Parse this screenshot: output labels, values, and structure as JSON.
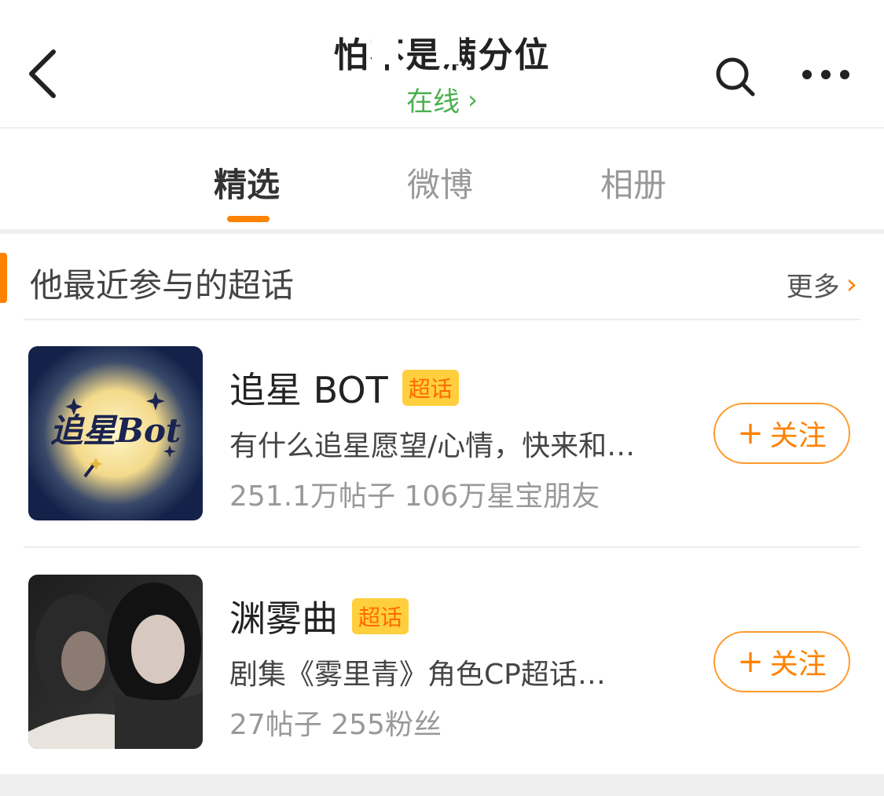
{
  "header": {
    "title": "怕不是满分位",
    "status": "在线",
    "status_chevron": "›",
    "back_icon": "back-icon",
    "search_icon": "search-icon",
    "more_icon": "more-icon"
  },
  "tabs": [
    {
      "label": "精选",
      "active": true
    },
    {
      "label": "微博",
      "active": false
    },
    {
      "label": "相册",
      "active": false
    }
  ],
  "section": {
    "title": "他最近参与的超话",
    "more_label": "更多",
    "more_chevron": "›"
  },
  "items": [
    {
      "name": "追星 BOT",
      "badge": "超话",
      "description": "有什么追星愿望/心情，快来和…",
      "stats": "251.1万帖子 106万星宝朋友",
      "follow_label": "关注",
      "follow_plus": "+",
      "thumb_text": "追星Bot"
    },
    {
      "name": "渊雾曲",
      "badge": "超话",
      "description": "剧集《雾里青》角色CP超话…",
      "stats": "27帖子 255粉丝",
      "follow_label": "关注",
      "follow_plus": "+"
    }
  ],
  "colors": {
    "accent": "#ff8200",
    "online": "#4caf50",
    "badge_bg": "#ffcf3e",
    "badge_text": "#ff6a00"
  }
}
